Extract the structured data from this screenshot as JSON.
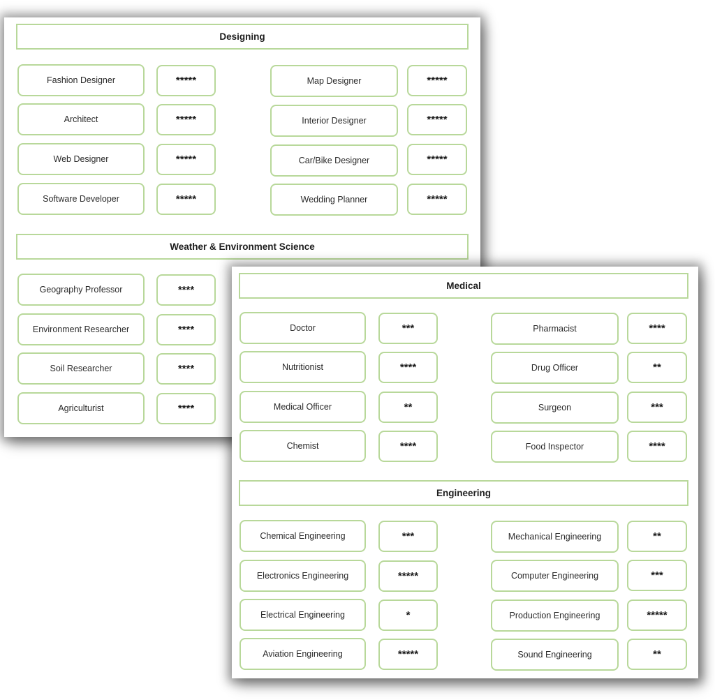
{
  "panels": [
    {
      "sections": [
        {
          "title": "Designing",
          "left": [
            {
              "name": "Fashion Designer",
              "rating": 5,
              "stars": "*****"
            },
            {
              "name": "Architect",
              "rating": 5,
              "stars": "*****"
            },
            {
              "name": "Web Designer",
              "rating": 5,
              "stars": "*****"
            },
            {
              "name": "Software Developer",
              "rating": 5,
              "stars": "*****"
            }
          ],
          "right": [
            {
              "name": "Map Designer",
              "rating": 5,
              "stars": "*****"
            },
            {
              "name": "Interior Designer",
              "rating": 5,
              "stars": "*****"
            },
            {
              "name": "Car/Bike Designer",
              "rating": 5,
              "stars": "*****"
            },
            {
              "name": "Wedding Planner",
              "rating": 5,
              "stars": "*****"
            }
          ]
        },
        {
          "title": "Weather & Environment Science",
          "left": [
            {
              "name": "Geography Professor",
              "rating": 4,
              "stars": "****"
            },
            {
              "name": "Environment Researcher",
              "rating": 4,
              "stars": "****"
            },
            {
              "name": "Soil Researcher",
              "rating": 4,
              "stars": "****"
            },
            {
              "name": "Agriculturist",
              "rating": 4,
              "stars": "****"
            }
          ],
          "right": []
        }
      ]
    },
    {
      "sections": [
        {
          "title": "Medical",
          "left": [
            {
              "name": "Doctor",
              "rating": 3,
              "stars": "***"
            },
            {
              "name": "Nutritionist",
              "rating": 4,
              "stars": "****"
            },
            {
              "name": "Medical Officer",
              "rating": 2,
              "stars": "**"
            },
            {
              "name": "Chemist",
              "rating": 4,
              "stars": "****"
            }
          ],
          "right": [
            {
              "name": "Pharmacist",
              "rating": 4,
              "stars": "****"
            },
            {
              "name": "Drug Officer",
              "rating": 2,
              "stars": "**"
            },
            {
              "name": "Surgeon",
              "rating": 3,
              "stars": "***"
            },
            {
              "name": "Food Inspector",
              "rating": 4,
              "stars": "****"
            }
          ]
        },
        {
          "title": "Engineering",
          "left": [
            {
              "name": "Chemical Engineering",
              "rating": 3,
              "stars": "***"
            },
            {
              "name": "Electronics Engineering",
              "rating": 5,
              "stars": "*****"
            },
            {
              "name": "Electrical Engineering",
              "rating": 1,
              "stars": "*"
            },
            {
              "name": "Aviation Engineering",
              "rating": 5,
              "stars": "*****"
            }
          ],
          "right": [
            {
              "name": "Mechanical Engineering",
              "rating": 2,
              "stars": "**"
            },
            {
              "name": "Computer Engineering",
              "rating": 3,
              "stars": "***"
            },
            {
              "name": "Production Engineering",
              "rating": 5,
              "stars": "*****"
            },
            {
              "name": "Sound Engineering",
              "rating": 2,
              "stars": "**"
            }
          ]
        }
      ]
    }
  ]
}
